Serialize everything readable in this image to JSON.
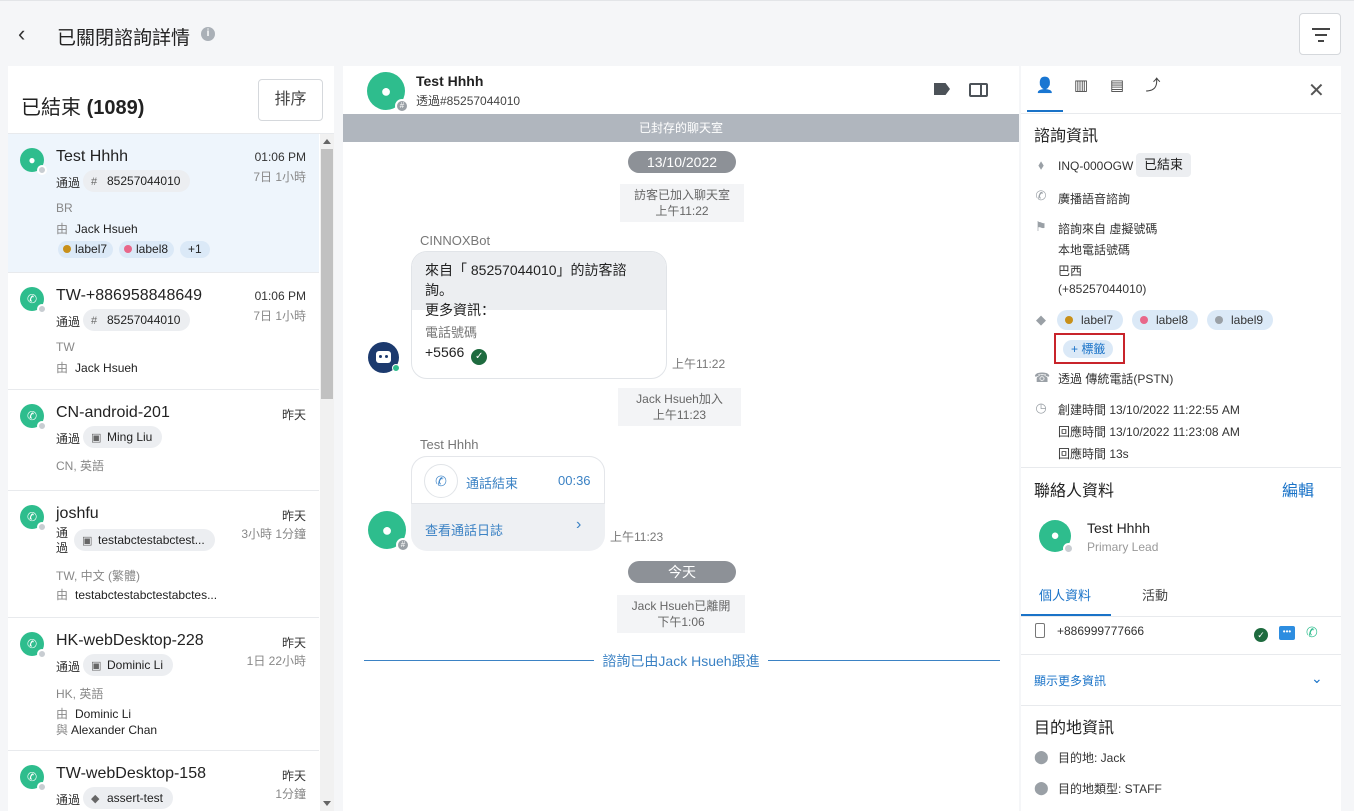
{
  "header": {
    "title": "已關閉諮詢詳情"
  },
  "left": {
    "title_prefix": "已結束 ",
    "count": "(1089)",
    "sort_label": "排序",
    "items": [
      {
        "name": "Test Hhhh",
        "time": "01:06 PM",
        "duration": "7日 1小時",
        "via_label": "通過",
        "via": "85257044010",
        "meta": "BR",
        "by_label": "由",
        "by": "Jack Hsueh",
        "labels": [
          "label7",
          "label8",
          "+1"
        ]
      },
      {
        "name": "TW-+886958848649",
        "time": "01:06 PM",
        "duration": "7日 1小時",
        "via_label": "通過",
        "via": "85257044010",
        "meta": "TW",
        "by_label": "由",
        "by": "Jack Hsueh"
      },
      {
        "name": "CN-android-201",
        "time": "昨天",
        "via_label": "通過",
        "via": "Ming Liu",
        "meta": "CN, 英語"
      },
      {
        "name": "joshfu",
        "time": "昨天",
        "duration": "3小時 1分鐘",
        "via_label": "通過",
        "via": "testabctestabctest...",
        "meta": "TW, 中文 (繁體)",
        "by_label": "由",
        "by": "testabctestabctestabctes..."
      },
      {
        "name": "HK-webDesktop-228",
        "time": "昨天",
        "duration": "1日 22小時",
        "via_label": "通過",
        "via": "Dominic Li",
        "meta": "HK, 英語",
        "by_label": "由",
        "by": "Dominic Li",
        "with_label": "與",
        "with": "Alexander Chan"
      },
      {
        "name": "TW-webDesktop-158",
        "time": "昨天",
        "duration": "1分鐘",
        "via_label": "通過",
        "via": "assert-test"
      }
    ]
  },
  "chat": {
    "name": "Test Hhhh",
    "via": "透過#85257044010",
    "archived": "已封存的聊天室",
    "date1": "13/10/2022",
    "sys1": "訪客已加入聊天室",
    "sys1_time": "上午11:22",
    "bot_name": "CINNOXBot",
    "bot_msg_line1": "來自「 85257044010」的訪客諮詢。",
    "bot_msg_line2": "更多資訊：",
    "phone_label": "電話號碼",
    "phone_value": "+5566",
    "bot_time": "上午11:22",
    "sys2": "Jack Hsueh加入",
    "sys2_time": "上午11:23",
    "user_name": "Test Hhhh",
    "call_ended": "通話結束",
    "call_duration": "00:36",
    "call_log": "查看通話日誌",
    "user_time": "上午11:23",
    "date2": "今天",
    "sys3": "Jack Hsueh已離開",
    "sys3_time": "下午1:06",
    "follow": "諮詢已由Jack Hsueh跟進"
  },
  "right": {
    "inquiry_title": "諮詢資訊",
    "inquiry_id": "INQ-000OGW",
    "status": "已結束",
    "type": "廣播語音諮詢",
    "source_line1": "諮詢來自 虛擬號碼",
    "source_line2": "本地電話號碼",
    "source_line3": "巴西",
    "source_line4": "(+85257044010)",
    "labels": [
      "label7",
      "label8",
      "label9"
    ],
    "add_tag": "+ 標籤",
    "channel": "透過 傳統電話(PSTN)",
    "created": "創建時間 13/10/2022 11:22:55 AM",
    "responded": "回應時間 13/10/2022 11:23:08 AM",
    "response_time": "回應時間 13s",
    "contact_title": "聯絡人資料",
    "edit": "編輯",
    "contact_name": "Test Hhhh",
    "contact_role": "Primary Lead",
    "tab_profile": "個人資料",
    "tab_activity": "活動",
    "contact_phone": "+886999777666",
    "show_more": "顯示更多資訊",
    "dest_title": "目的地資訊",
    "dest": "目的地:  Jack",
    "dest_type": "目的地類型:  STAFF"
  },
  "colors": {
    "accent": "#1a73c8",
    "green": "#2ebd8d",
    "label7": "#c8901a",
    "label8": "#e8678a",
    "label9": "#9aa0a6",
    "highlight": "#c8242b"
  }
}
